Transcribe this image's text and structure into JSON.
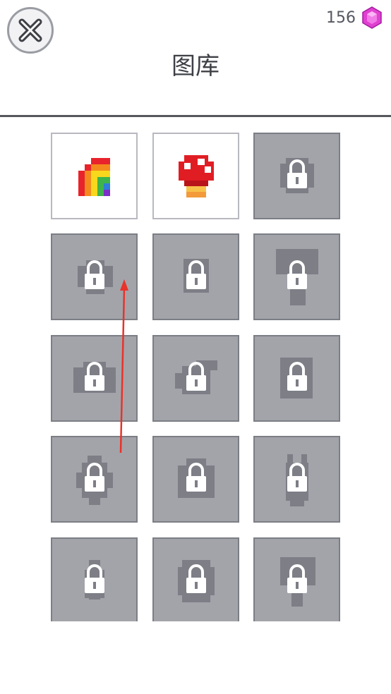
{
  "header": {
    "title": "图库",
    "gem_count": "156",
    "close_icon": "close-x-icon",
    "gem_icon": "pink-gem-icon"
  },
  "colors": {
    "locked_tile_bg": "#a3a4aa",
    "locked_silhouette": "#7d7e86",
    "lock_icon": "#ffffff",
    "gem": "#e040d0",
    "arrow": "#e8332a"
  },
  "gallery": {
    "tiles": [
      {
        "name": "rainbow",
        "state": "unlocked",
        "icon": "rainbow-pixel-art"
      },
      {
        "name": "mushroom",
        "state": "unlocked",
        "icon": "mushroom-pixel-art"
      },
      {
        "name": "locked-3",
        "state": "locked",
        "icon": "lock-icon"
      },
      {
        "name": "locked-4",
        "state": "locked",
        "icon": "lock-icon"
      },
      {
        "name": "locked-5",
        "state": "locked",
        "icon": "lock-icon"
      },
      {
        "name": "locked-6",
        "state": "locked",
        "icon": "lock-icon"
      },
      {
        "name": "locked-7",
        "state": "locked",
        "icon": "lock-icon"
      },
      {
        "name": "locked-8",
        "state": "locked",
        "icon": "lock-icon"
      },
      {
        "name": "locked-9",
        "state": "locked",
        "icon": "lock-icon"
      },
      {
        "name": "locked-10",
        "state": "locked",
        "icon": "lock-icon"
      },
      {
        "name": "locked-11",
        "state": "locked",
        "icon": "lock-icon"
      },
      {
        "name": "locked-12",
        "state": "locked",
        "icon": "lock-icon"
      },
      {
        "name": "locked-13",
        "state": "locked",
        "icon": "lock-icon"
      },
      {
        "name": "locked-14",
        "state": "locked",
        "icon": "lock-icon"
      },
      {
        "name": "locked-15",
        "state": "locked",
        "icon": "lock-icon"
      }
    ]
  },
  "annotation": {
    "icon": "red-swipe-up-arrow"
  }
}
